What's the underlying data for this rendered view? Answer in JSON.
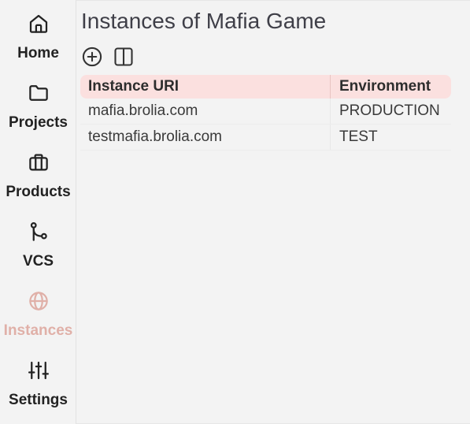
{
  "sidebar": {
    "items": [
      {
        "label": "Home",
        "icon": "home-icon",
        "active": false
      },
      {
        "label": "Projects",
        "icon": "folder-icon",
        "active": false
      },
      {
        "label": "Products",
        "icon": "briefcase-icon",
        "active": false
      },
      {
        "label": "VCS",
        "icon": "branch-icon",
        "active": false
      },
      {
        "label": "Instances",
        "icon": "globe-icon",
        "active": true
      },
      {
        "label": "Settings",
        "icon": "sliders-icon",
        "active": false
      }
    ],
    "active_color": "#e0b0a8"
  },
  "page": {
    "title": "Instances of Mafia Game"
  },
  "toolbar": {
    "add_icon": "plus-circle-icon",
    "layout_icon": "split-view-icon"
  },
  "table": {
    "columns": [
      "Instance URI",
      "Environment"
    ],
    "rows": [
      {
        "uri": "mafia.brolia.com",
        "environment": "PRODUCTION"
      },
      {
        "uri": "testmafia.brolia.com",
        "environment": "TEST"
      }
    ],
    "header_color": "#fbe0df"
  }
}
